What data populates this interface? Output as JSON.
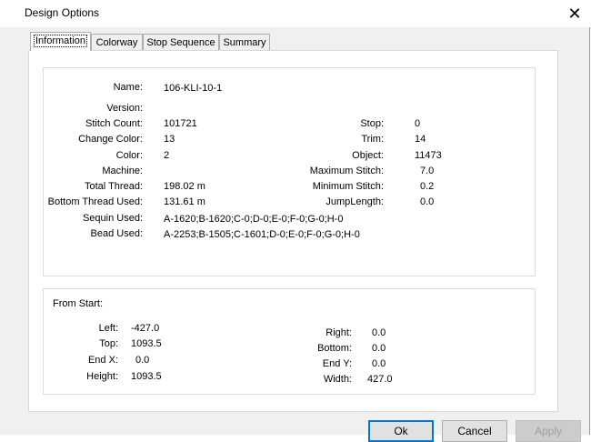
{
  "window": {
    "title": "Design Options",
    "close_glyph": "✕"
  },
  "tabs": [
    {
      "label": "Information",
      "active": true
    },
    {
      "label": "Colorway",
      "active": false
    },
    {
      "label": "Stop Sequence",
      "active": false
    },
    {
      "label": "Summary",
      "active": false
    }
  ],
  "info": {
    "name": {
      "label": "Name:",
      "value": "106-KLI-10-1"
    },
    "version": {
      "label": "Version:",
      "value": ""
    },
    "stitch_count": {
      "label": "Stitch Count:",
      "value": "101721"
    },
    "change_color": {
      "label": "Change Color:",
      "value": "13"
    },
    "color": {
      "label": "Color:",
      "value": "2"
    },
    "machine": {
      "label": "Machine:",
      "value": ""
    },
    "total_thread": {
      "label": "Total Thread:",
      "value": "198.02 m"
    },
    "bottom_thread": {
      "label": "Bottom Thread Used:",
      "value": "131.61 m"
    },
    "sequin_used": {
      "label": "Sequin Used:",
      "value": "A-1620;B-1620;C-0;D-0;E-0;F-0;G-0;H-0"
    },
    "bead_used": {
      "label": "Bead Used:",
      "value": "A-2253;B-1505;C-1601;D-0;E-0;F-0;G-0;H-0"
    },
    "stop": {
      "label": "Stop:",
      "value": "0"
    },
    "trim": {
      "label": "Trim:",
      "value": "14"
    },
    "object": {
      "label": "Object:",
      "value": "11473"
    },
    "max_stitch": {
      "label": "Maximum Stitch:",
      "value": "7.0"
    },
    "min_stitch": {
      "label": "Minimum Stitch:",
      "value": "0.2"
    },
    "jump_length": {
      "label": "JumpLength:",
      "value": "0.0"
    }
  },
  "from_start": {
    "heading": "From Start:",
    "left": {
      "label": "Left:",
      "value": "-427.0"
    },
    "top": {
      "label": "Top:",
      "value": "1093.5"
    },
    "end_x": {
      "label": "End X:",
      "value": "0.0"
    },
    "height": {
      "label": "Height:",
      "value": "1093.5"
    },
    "right": {
      "label": "Right:",
      "value": "0.0"
    },
    "bottom": {
      "label": "Bottom:",
      "value": "0.0"
    },
    "end_y": {
      "label": "End Y:",
      "value": "0.0"
    },
    "width": {
      "label": "Width:",
      "value": "427.0"
    }
  },
  "buttons": {
    "ok": "Ok",
    "cancel": "Cancel",
    "apply": "Apply"
  },
  "colors": {
    "default_button_border": "#0078d7",
    "dialog_bg": "#f0f0f0"
  }
}
